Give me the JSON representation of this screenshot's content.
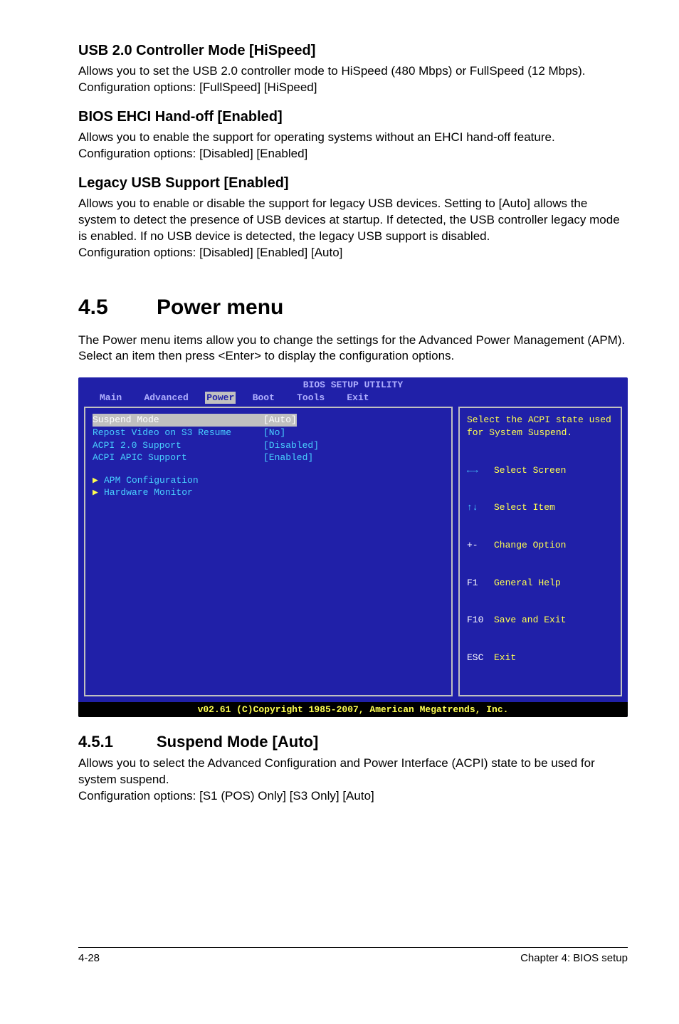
{
  "sections": {
    "usb20": {
      "heading": "USB 2.0 Controller Mode [HiSpeed]",
      "body": "Allows you to set the USB 2.0 controller mode to HiSpeed (480 Mbps) or FullSpeed (12 Mbps). Configuration options: [FullSpeed] [HiSpeed]"
    },
    "ehci": {
      "heading": "BIOS EHCI Hand-off [Enabled]",
      "body": "Allows you to enable the support for operating systems without an EHCI hand-off feature. Configuration options: [Disabled] [Enabled]"
    },
    "legacy": {
      "heading": "Legacy USB Support [Enabled]",
      "body1": "Allows you to enable or disable the support for legacy USB devices. Setting to [Auto] allows the system to detect the presence of USB devices at startup. If detected, the USB controller legacy mode is enabled. If no USB device is detected, the legacy USB support is disabled.",
      "body2": "Configuration options: [Disabled] [Enabled] [Auto]"
    },
    "power": {
      "num": "4.5",
      "title": "Power menu",
      "body": "The Power menu items allow you to change the settings for the Advanced Power Management (APM). Select an item then press <Enter> to display the configuration options."
    },
    "suspend": {
      "num": "4.5.1",
      "title": "Suspend Mode [Auto]",
      "body1": "Allows you to select the Advanced Configuration and Power Interface (ACPI) state to be used for system suspend.",
      "body2": "Configuration options: [S1 (POS) Only] [S3 Only] [Auto]"
    }
  },
  "bios": {
    "title": "BIOS SETUP UTILITY",
    "tabs": {
      "main": "Main",
      "advanced": "Advanced",
      "power": "Power",
      "boot": "Boot",
      "tools": "Tools",
      "exit": "Exit"
    },
    "rows": {
      "suspend": {
        "label": "Suspend Mode",
        "value": "[Auto]"
      },
      "repost": {
        "label": "Repost Video on S3 Resume",
        "value": "[No]"
      },
      "acpi20": {
        "label": "ACPI 2.0 Support",
        "value": "[Disabled]"
      },
      "apic": {
        "label": "ACPI APIC Support",
        "value": "[Enabled]"
      },
      "apm": {
        "label": "APM Configuration"
      },
      "hw": {
        "label": "Hardware Monitor"
      }
    },
    "help": {
      "text": "Select the ACPI state used for System Suspend.",
      "keys": {
        "lr": "Select Screen",
        "ud": "Select Item",
        "pm": "Change Option",
        "f1": "General Help",
        "f10": "Save and Exit",
        "esc": "Exit"
      },
      "keylabels": {
        "pm": "+-",
        "f1": "F1",
        "f10": "F10",
        "esc": "ESC"
      }
    },
    "footer": "v02.61 (C)Copyright 1985-2007, American Megatrends, Inc."
  },
  "footer": {
    "left": "4-28",
    "right": "Chapter 4: BIOS setup"
  }
}
